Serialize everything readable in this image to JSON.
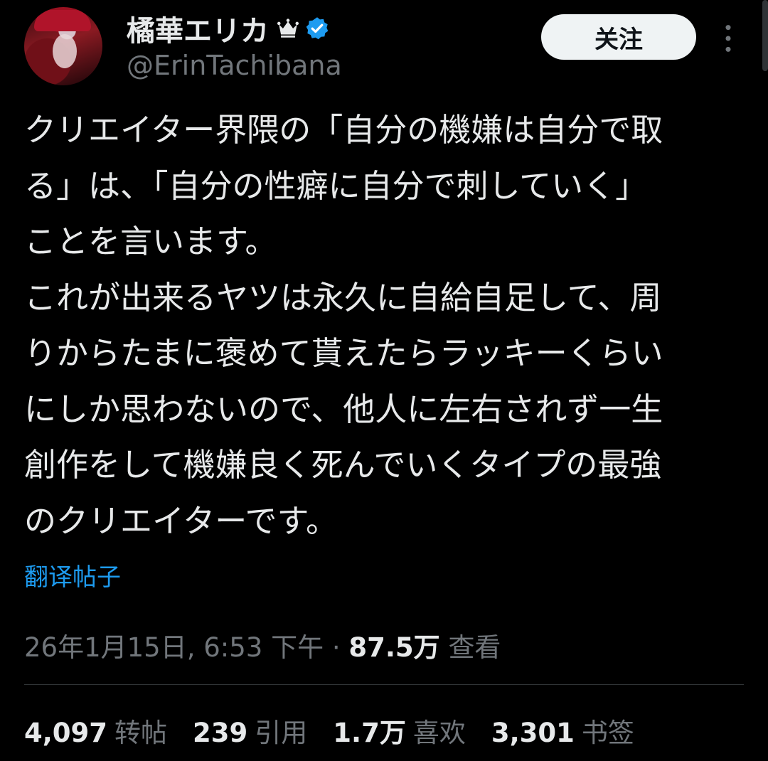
{
  "user": {
    "display_name": "橘華エリカ",
    "handle": "@ErinTachibana",
    "follow_label": "关注",
    "icons": {
      "crown": "crown-icon",
      "verified": "verified-badge-icon",
      "more": "more-vertical-icon"
    },
    "verified_color": "#1d9bf0"
  },
  "tweet": {
    "lines": [
      "クリエイター界隈の「自分の機嫌は自分で取",
      "る」は、「自分の性癖に自分で刺していく」",
      "ことを言います。",
      "これが出来るヤツは永久に自給自足して、周",
      "りからたまに褒めて貰えたらラッキーくらい",
      "にしか思わないので、他人に左右されず一生",
      "創作をして機嫌良く死んでいくタイプの最強",
      "のクリエイターです。"
    ],
    "translate_label": "翻译帖子"
  },
  "meta": {
    "timestamp": "26年1月15日, 6:53 下午",
    "separator": " · ",
    "views_count": "87.5万",
    "views_label": "查看"
  },
  "stats": {
    "reposts": {
      "num": "4,097",
      "label": "转帖"
    },
    "quotes": {
      "num": "239",
      "label": "引用"
    },
    "likes": {
      "num": "1.7万",
      "label": "喜欢"
    },
    "bookmarks": {
      "num": "3,301",
      "label": "书签"
    }
  },
  "colors": {
    "background": "#000000",
    "text": "#e7e9ea",
    "muted": "#71767b",
    "link": "#1d9bf0"
  }
}
